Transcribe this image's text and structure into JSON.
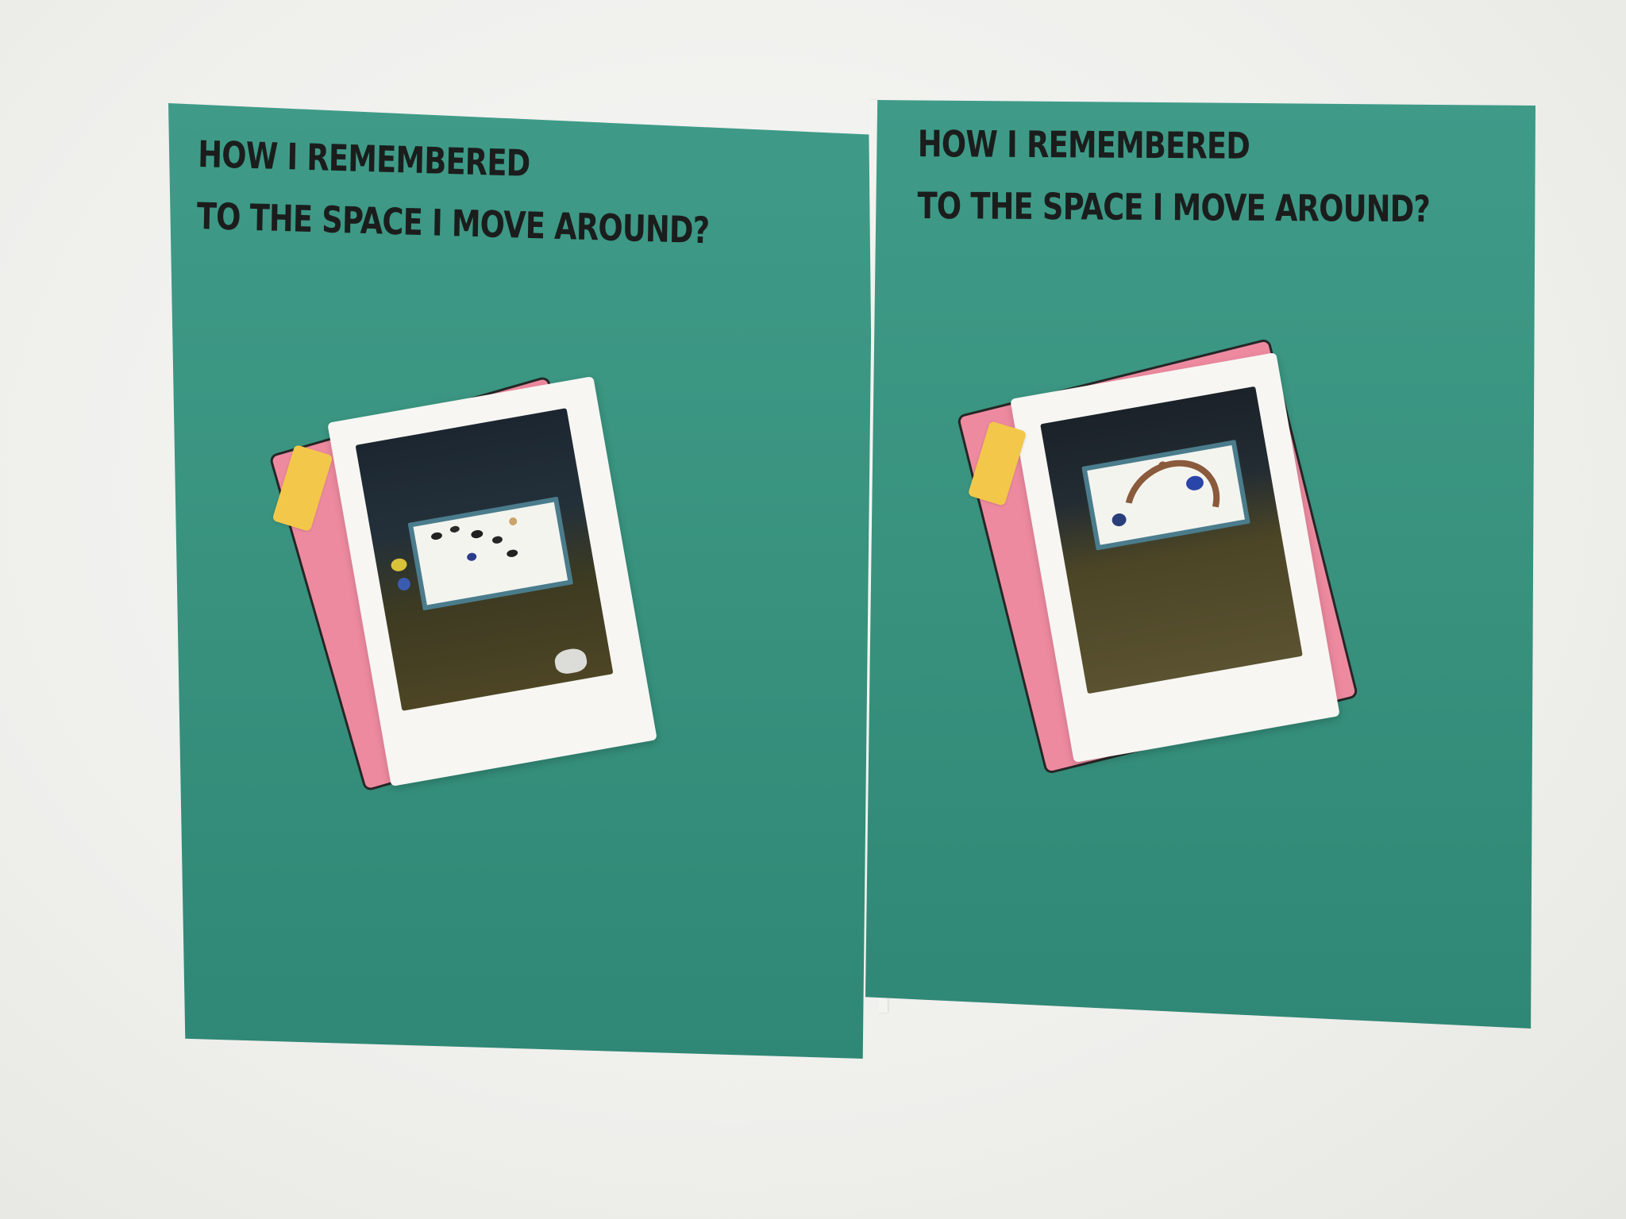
{
  "posters": [
    {
      "headline": {
        "line1": "HOW I REMEMBERED",
        "line2": "TO THE SPACE I MOVE AROUND?"
      }
    },
    {
      "headline": {
        "line1": "HOW I REMEMBERED",
        "line2": "TO THE SPACE I MOVE AROUND?"
      }
    }
  ],
  "colors": {
    "wall": "#efefec",
    "poster": "#3a957f",
    "pink_card": "#ee8aa0",
    "tape": "#f3c84a",
    "polaroid_frame": "#f7f6f3",
    "text": "#1b1d1c"
  }
}
